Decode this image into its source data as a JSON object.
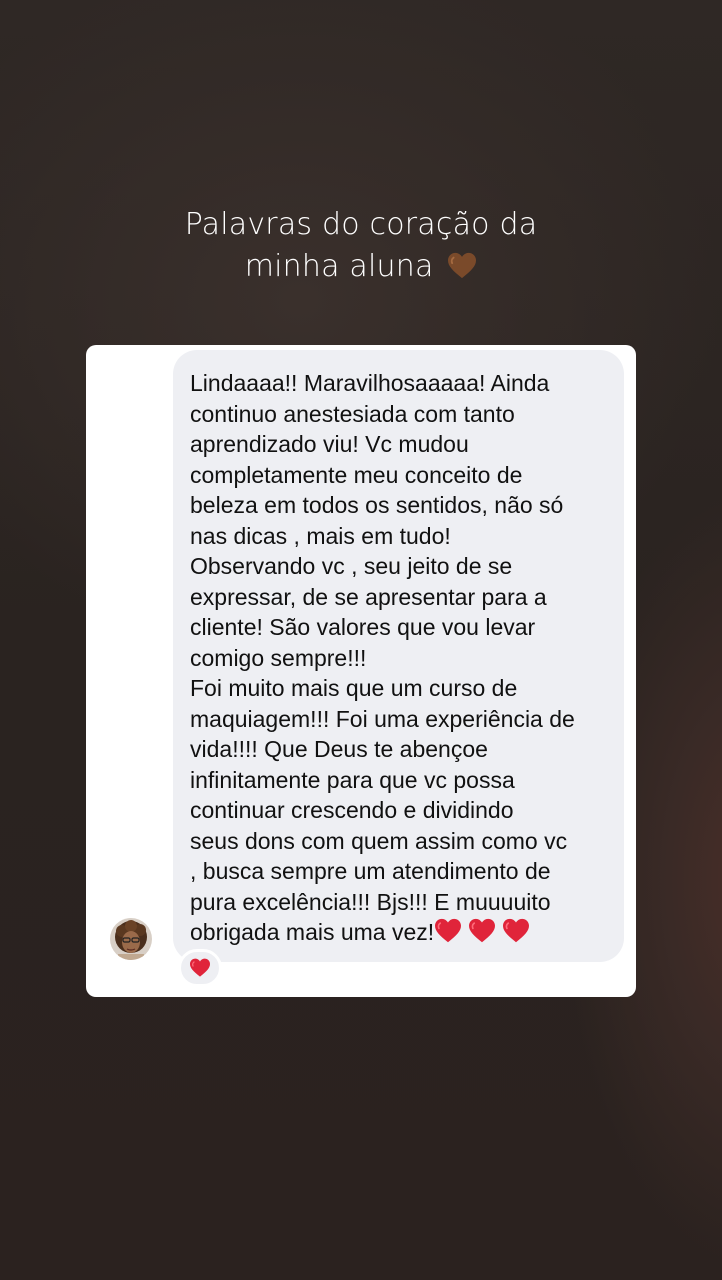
{
  "story": {
    "caption_line1": "Palavras do coração da",
    "caption_line2": "minha aluna",
    "caption_emoji": "brown-heart-icon"
  },
  "message": {
    "text": "Lindaaaa!! Maravilhosaaaaa! Ainda\ncontinuo anestesiada com tanto\naprendizado viu! Vc mudou\ncompletamente meu conceito de\nbeleza em todos os sentidos, não só\nnas dicas , mais em tudo!\nObservando vc , seu jeito de se\nexpressar, de se apresentar para a\ncliente! São valores que vou levar\ncomigo sempre!!!\nFoi muito mais que um curso de\nmaquiagem!!! Foi uma experiência de\nvida!!!! Que Deus te abençoe\ninfinitamente para que vc possa\ncontinuar crescendo e dividindo\nseus dons com quem assim como vc\n, busca sempre um atendimento de\npura excelência!!! Bjs!!! E muuuuito\nobrigada mais uma vez!",
    "trailing_emojis": [
      "red-heart-icon",
      "red-heart-icon",
      "red-heart-icon"
    ],
    "reaction": "red-heart-icon",
    "avatar": "avatar"
  },
  "colors": {
    "bubble": "#eeeff3",
    "card": "#ffffff",
    "heart_red": "#e0243a",
    "heart_brown": "#7a4a2a"
  }
}
